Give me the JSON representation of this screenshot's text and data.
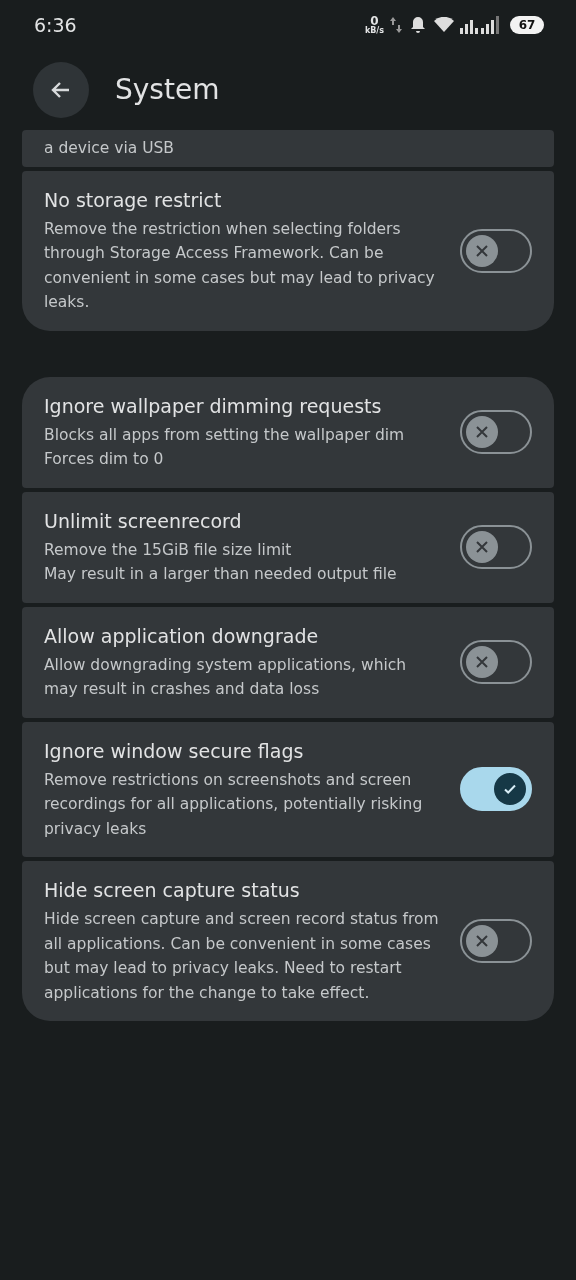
{
  "status_bar": {
    "time": "6:36",
    "net_speed": "0",
    "net_unit": "kB/s",
    "battery": "67"
  },
  "header": {
    "title": "System"
  },
  "groups": [
    {
      "items": [
        {
          "description": "a device via USB"
        },
        {
          "title": "No storage restrict",
          "description": "Remove the restriction when selecting folders through Storage Access Framework. Can be convenient in some cases but may lead to privacy leaks.",
          "on": false
        }
      ]
    },
    {
      "items": [
        {
          "title": "Ignore wallpaper dimming requests",
          "description": "Blocks all apps from setting the wallpaper dim\nForces dim to 0",
          "on": false
        },
        {
          "title": "Unlimit screenrecord",
          "description": "Remove the 15GiB file size limit\nMay result in a larger than needed output file",
          "on": false
        },
        {
          "title": "Allow application downgrade",
          "description": "Allow downgrading system applications, which may result in crashes and data loss",
          "on": false
        },
        {
          "title": "Ignore window secure flags",
          "description": "Remove restrictions on screenshots and screen recordings for all applications, potentially risking privacy leaks",
          "on": true
        },
        {
          "title": "Hide screen capture status",
          "description": "Hide screen capture and screen record status from all applications. Can be convenient in some cases but may lead to privacy leaks. Need to restart applications for the change to take effect.",
          "on": false
        }
      ]
    }
  ]
}
